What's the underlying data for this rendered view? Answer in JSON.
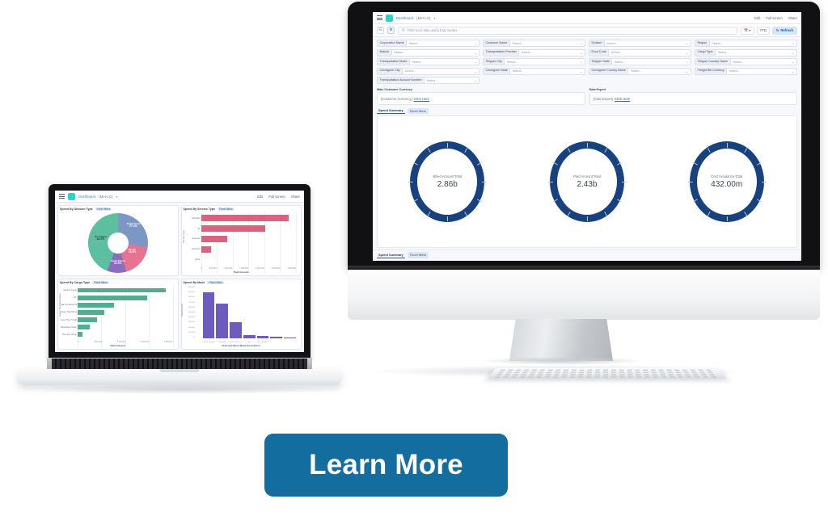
{
  "app": {
    "topbar": {
      "menu_icon": "hamburger-icon",
      "logo_icon": "elastic-logo-icon",
      "breadcrumb_home": "Dashboard",
      "breadcrumb_current": "[Met-LG]",
      "chevron_icon": "chevron-down-icon",
      "full_screen": "Full screen",
      "share": "Share",
      "edit": "Edit"
    },
    "searchbar": {
      "filter_icon": "filter-icon",
      "settings_icon": "gear-icon",
      "search_icon": "search-icon",
      "placeholder": "Filter your data using KQL syntax",
      "calendar_icon": "calendar-icon",
      "date_range": "YTD",
      "refresh_icon": "refresh-icon",
      "refresh_label": "Refresh"
    },
    "filters": [
      {
        "label": "Corporation Name",
        "value": "Select..."
      },
      {
        "label": "Customer Name",
        "value": "Select..."
      },
      {
        "label": "Division",
        "value": "Select..."
      },
      {
        "label": "Region",
        "value": "Select..."
      },
      {
        "label": "Branch",
        "value": "Select..."
      },
      {
        "label": "Transportation Provider",
        "value": "Select..."
      },
      {
        "label": "Econ Code",
        "value": "Select..."
      },
      {
        "label": "Cargo Type",
        "value": "Select..."
      },
      {
        "label": "Transportation Mode",
        "value": "Select..."
      },
      {
        "label": "Shipper City",
        "value": "Select..."
      },
      {
        "label": "Shipper State",
        "value": "Select..."
      },
      {
        "label": "Shipper Country Name",
        "value": "Select..."
      },
      {
        "label": "Consignee City",
        "value": "Select..."
      },
      {
        "label": "Consignee State",
        "value": "Select..."
      },
      {
        "label": "Consignee Country Name",
        "value": "Select..."
      },
      {
        "label": "Freight Bill Currency",
        "value": "Select..."
      },
      {
        "label": "Transportation Account Number",
        "value": "Select..."
      }
    ],
    "link_cards": [
      {
        "title": "Main Customer Currency",
        "text": "[Customer Currency]",
        "link": "Click Here"
      },
      {
        "title": "Data Export",
        "text": "[Data Export]",
        "link": "Click Here"
      }
    ],
    "tabs": [
      {
        "label": "Spend Summary",
        "active": true
      },
      {
        "label": "Panel filters",
        "active": false
      }
    ],
    "gauges": [
      {
        "label": "Billed Amount Total",
        "value": "2.86b"
      },
      {
        "label": "Paid Amount Total",
        "value": "2.43b"
      },
      {
        "label": "Cost Avoidance Total",
        "value": "432.00m"
      }
    ]
  },
  "laptop": {
    "topbar": {
      "menu_icon": "hamburger-icon",
      "logo_icon": "elastic-logo-icon",
      "breadcrumb_home": "Dashboard",
      "breadcrumb_current": "[Met-LG]",
      "full_screen": "Full screen",
      "share": "Share",
      "edit": "Edit"
    },
    "panel_filter_chip": "Panel filters",
    "panels": [
      {
        "title": "Spend By Division Type"
      },
      {
        "title": "Spend By Service Type"
      },
      {
        "title": "Spend By Cargo Type"
      },
      {
        "title": "Spend By Mode"
      }
    ]
  },
  "chart_data": [
    {
      "type": "pie",
      "title": "Spend By Division Type",
      "labels": [
        "Road Truck",
        "Ocean",
        "Small Parcel",
        "Air Freight"
      ],
      "values": [
        27.2,
        18.3,
        10.5,
        44.0
      ],
      "value_labels": [
        "27.2%",
        "18.3%",
        "10.5%",
        "44.0%"
      ],
      "colors": [
        "#7d97c4",
        "#e6738f",
        "#8a6dbf",
        "#5bbfa0"
      ],
      "legend": "none"
    },
    {
      "type": "bar",
      "orientation": "horizontal",
      "title": "Spend By Service Type",
      "categories": [
        "Standard",
        "Air",
        "Express",
        "Deferred",
        "Other"
      ],
      "values": [
        3000000,
        2200000,
        900000,
        350000,
        0
      ],
      "xlabel": "Paid Amount",
      "ylabel": "Service Type",
      "xticks": [
        "0",
        "500,000",
        "1,000,000",
        "1,500,000",
        "2,000,000",
        "2,500,000",
        "3,000,000"
      ],
      "color": "#d9637f",
      "grid": true
    },
    {
      "type": "bar",
      "orientation": "horizontal",
      "title": "Spend By Cargo Type",
      "categories": [
        "General Cargo",
        "LTL",
        "Full Truckload Cargo",
        "Heavy Machinery",
        "Less Than Truckload",
        "Hazardous Materials",
        "Oversize Cargo"
      ],
      "values": [
        3900000,
        3100000,
        1600000,
        1200000,
        850000,
        550000,
        230000
      ],
      "xlabel": "Paid Amount",
      "ylabel": "Cargo Type Description",
      "xticks": [
        "0",
        "1,000,000",
        "2,000,000",
        "3,000,000",
        "4,000,000"
      ],
      "color": "#4fae8f",
      "grid": true
    },
    {
      "type": "bar",
      "orientation": "vertical",
      "title": "Spend By Mode",
      "categories": [
        "Parcel Transportation",
        "Truckload",
        "Less Than Truckload",
        "Rail",
        "Air Transport"
      ],
      "values": [
        950000,
        720000,
        330000,
        60000,
        55000,
        30000,
        15000
      ],
      "xlabel": "Transportation Mode Description",
      "ylabel": "Paid Amount",
      "yticks": [
        "1,000,000",
        "900,000",
        "800,000",
        "700,000",
        "600,000",
        "500,000",
        "400,000",
        "300,000",
        "200,000",
        "100,000",
        "0"
      ],
      "color": "#6d5cbd",
      "grid": false
    }
  ],
  "cta": {
    "label": "Learn More",
    "color": "#136d9e"
  }
}
